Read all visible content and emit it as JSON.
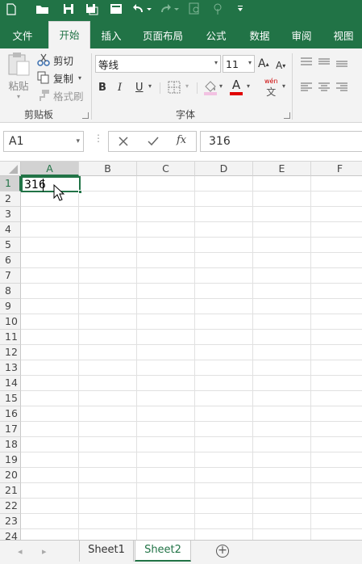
{
  "tabs": [
    "文件",
    "开始",
    "插入",
    "页面布局",
    "公式",
    "数据",
    "审阅",
    "视图"
  ],
  "active_tab": "开始",
  "clipboard": {
    "paste_label": "粘贴",
    "cut_label": "剪切",
    "copy_label": "复制",
    "format_painter_label": "格式刷",
    "group_label": "剪贴板"
  },
  "font": {
    "font_name": "等线",
    "font_size": "11",
    "bold_label": "B",
    "italic_label": "I",
    "underline_label": "U",
    "grow_label": "A",
    "shrink_label": "A",
    "color_label": "A",
    "phonetic_label": "wén",
    "phonetic_char": "文",
    "group_label": "字体"
  },
  "formula_bar": {
    "name_box": "A1",
    "value": "316",
    "fx_label": "fx"
  },
  "columns": [
    "A",
    "B",
    "C",
    "D",
    "E",
    "F"
  ],
  "rows": [
    "1",
    "2",
    "3",
    "4",
    "5",
    "6",
    "7",
    "8",
    "9",
    "10",
    "11",
    "12",
    "13",
    "14",
    "15",
    "16",
    "17",
    "18",
    "19",
    "20",
    "21",
    "22",
    "23",
    "24"
  ],
  "cells": {
    "A1": "316"
  },
  "sheets": [
    "Sheet1",
    "Sheet2"
  ],
  "active_sheet": "Sheet2",
  "colors": {
    "accent": "#217346",
    "header_bg": "#f3f3f3",
    "selected_header_bg": "#d2d2d2"
  }
}
